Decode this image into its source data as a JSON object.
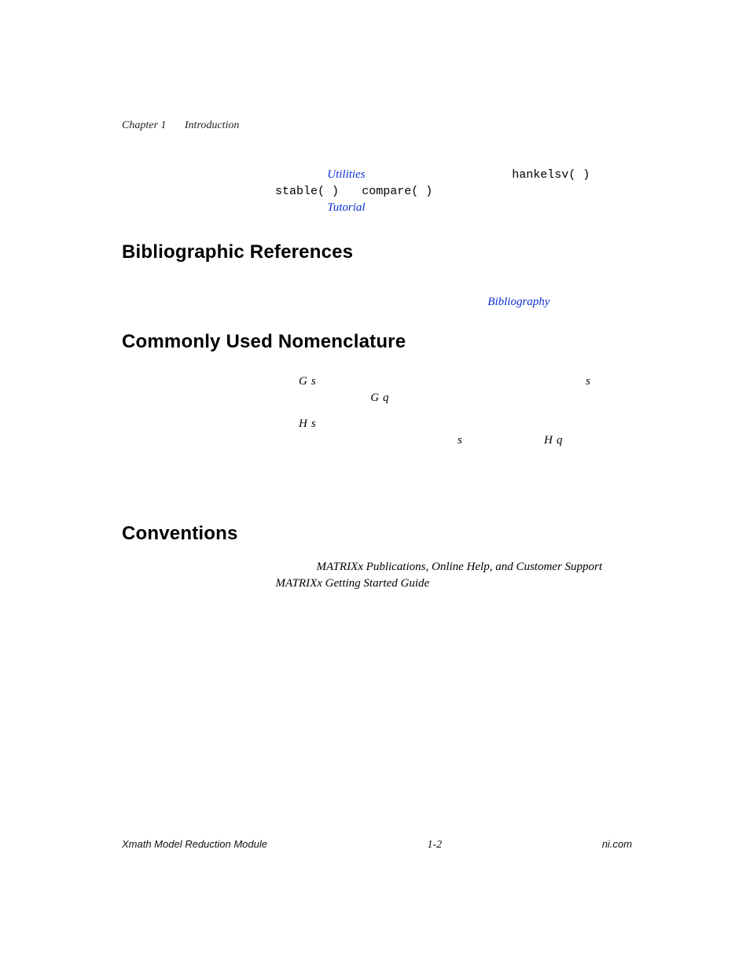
{
  "header": {
    "chapter": "Chapter 1",
    "title": "Introduction"
  },
  "para1": {
    "utilities_link": "Utilities",
    "hankelsv": "hankelsv( )",
    "stable": "stable( )",
    "compare": "compare( )",
    "tutorial_link": "Tutorial"
  },
  "section_bibrefs": "Bibliographic References",
  "bib": {
    "bibliography_link": "Bibliography"
  },
  "section_nomen": "Commonly Used Nomenclature",
  "nom": {
    "item1": {
      "G": "G",
      "s1": "s",
      "s2": "s",
      "Gq_G": "G",
      "Gq_q": "q"
    },
    "item2": {
      "H": "H",
      "s1": "s",
      "s2": "s",
      "Hq_H": "H",
      "Hq_q": "q"
    }
  },
  "section_conv": "Conventions",
  "conv": {
    "pubs_italic": "MATRIXx Publications, Online Help, and Customer Support",
    "guide_italic": "MATRIXx Getting Started Guide"
  },
  "footer": {
    "left": "Xmath Model Reduction Module",
    "center": "1-2",
    "right": "ni.com"
  }
}
